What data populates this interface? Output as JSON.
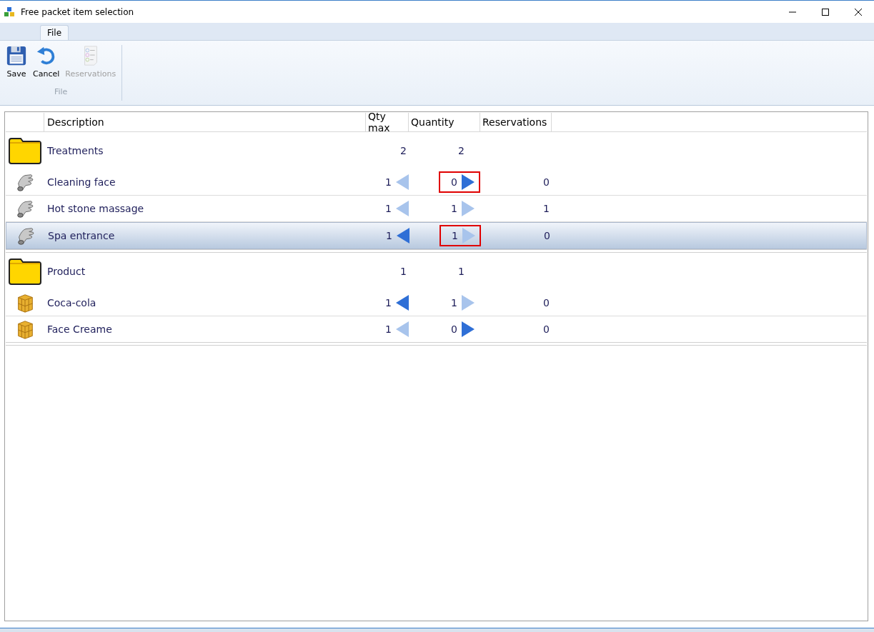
{
  "window": {
    "title": "Free packet item selection"
  },
  "ribbon": {
    "tabs": [
      {
        "label": "File",
        "selected": true
      }
    ],
    "buttons": [
      {
        "label": "Save",
        "kind": "save",
        "disabled": false
      },
      {
        "label": "Cancel",
        "kind": "cancel",
        "disabled": false
      },
      {
        "label": "Reservations",
        "kind": "reservations",
        "disabled": true
      }
    ],
    "group_label": "File"
  },
  "table": {
    "columns": [
      "Description",
      "Qty max",
      "Quantity",
      "Reservations"
    ],
    "groups": [
      {
        "name": "Treatments",
        "qty_max": "2",
        "quantity": "2",
        "items": [
          {
            "name": "Cleaning face",
            "kind": "service",
            "qty_max": "1",
            "quantity": "0",
            "reservations": "0",
            "decrease_enabled": false,
            "increase_enabled": true,
            "selected": false,
            "highlighted": true
          },
          {
            "name": "Hot stone massage",
            "kind": "service",
            "qty_max": "1",
            "quantity": "1",
            "reservations": "1",
            "decrease_enabled": false,
            "increase_enabled": false,
            "selected": false,
            "highlighted": false
          },
          {
            "name": "Spa entrance",
            "kind": "service",
            "qty_max": "1",
            "quantity": "1",
            "reservations": "0",
            "decrease_enabled": true,
            "increase_enabled": false,
            "selected": true,
            "highlighted": true
          }
        ]
      },
      {
        "name": "Product",
        "qty_max": "1",
        "quantity": "1",
        "items": [
          {
            "name": "Coca-cola",
            "kind": "product",
            "qty_max": "1",
            "quantity": "1",
            "reservations": "0",
            "decrease_enabled": true,
            "increase_enabled": false,
            "selected": false,
            "highlighted": false
          },
          {
            "name": "Face Creame",
            "kind": "product",
            "qty_max": "1",
            "quantity": "0",
            "reservations": "0",
            "decrease_enabled": false,
            "increase_enabled": true,
            "selected": false,
            "highlighted": false
          }
        ]
      }
    ]
  }
}
